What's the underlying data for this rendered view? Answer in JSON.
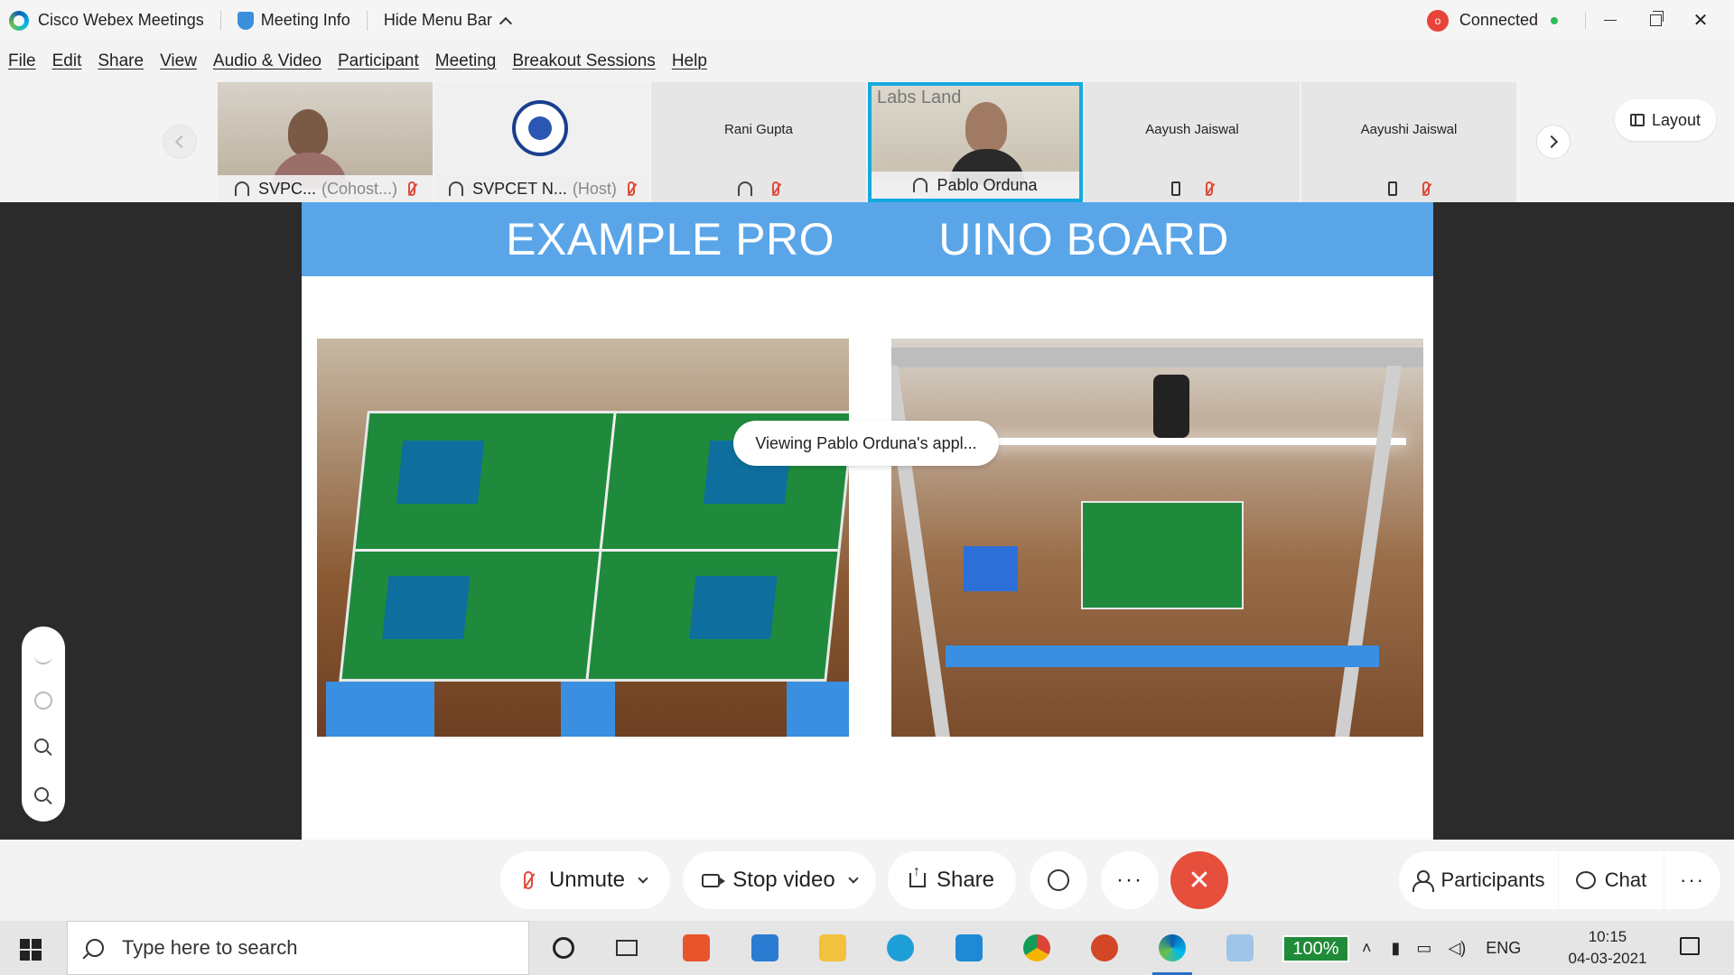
{
  "titlebar": {
    "app_name": "Cisco Webex Meetings",
    "meeting_info": "Meeting Info",
    "hide_menu": "Hide Menu Bar",
    "status": "Connected",
    "rec_label": "o"
  },
  "menu": [
    "File",
    "Edit",
    "Share",
    "View",
    "Audio & Video",
    "Participant",
    "Meeting",
    "Breakout Sessions",
    "Help"
  ],
  "participants": [
    {
      "name": "SVPC...",
      "role": "(Cohost...)",
      "type": "video-person"
    },
    {
      "name": "SVPCET N...",
      "role": "(Host)",
      "type": "logo"
    },
    {
      "name": "Rani Gupta",
      "role": "",
      "type": "name-only"
    },
    {
      "name": "Pablo Orduna",
      "role": "",
      "type": "video-active"
    },
    {
      "name": "Aayush Jaiswal",
      "role": "",
      "type": "phone"
    },
    {
      "name": "Aayushi Jaiswal",
      "role": "",
      "type": "phone"
    }
  ],
  "layout_label": "Layout",
  "share": {
    "slide_title": "EXAMPLE PRO        UINO BOARD",
    "viewing": "Viewing Pablo Orduna's appl...",
    "photo_brand": "Labs Land"
  },
  "controls": {
    "unmute": "Unmute",
    "stop_video": "Stop video",
    "share": "Share",
    "more": "···",
    "end": "✕",
    "participants": "Participants",
    "chat": "Chat",
    "overflow": "···"
  },
  "taskbar": {
    "search_placeholder": "Type here to search",
    "battery": "100%",
    "lang": "ENG",
    "time": "10:15",
    "date": "04-03-2021"
  },
  "colors": {
    "accent": "#15a9e0",
    "end_call": "#e64f3c",
    "banner": "#5aa5e8",
    "mute": "#e04a3a"
  }
}
